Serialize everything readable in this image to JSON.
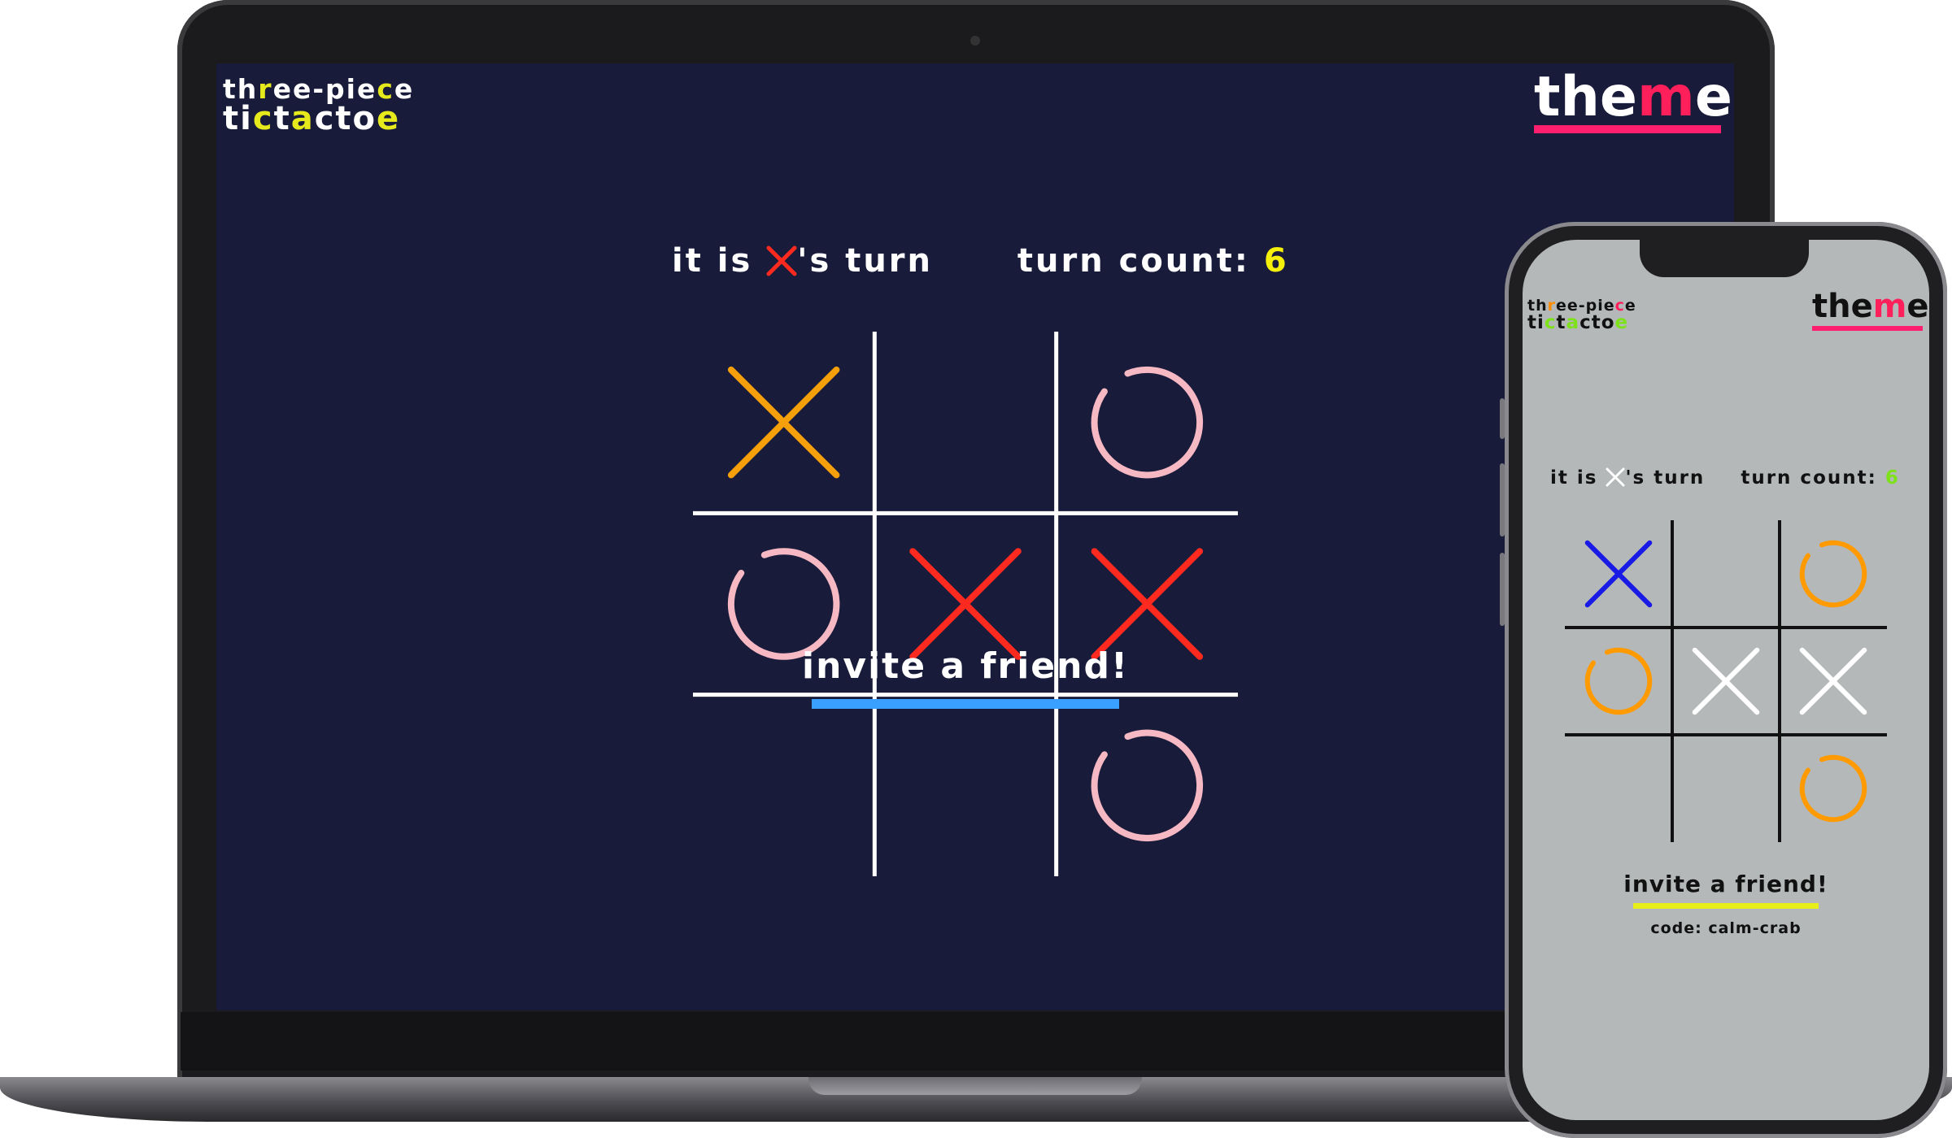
{
  "laptop": {
    "brand": {
      "line1": [
        "th",
        "r",
        "ee-pie",
        "c",
        "e"
      ],
      "line2": [
        "ti",
        "c",
        "t",
        "a",
        "cto",
        "e"
      ]
    },
    "theme_label": [
      "the",
      "m",
      "e"
    ],
    "status": {
      "prefix": "it is",
      "suffix": "'s turn",
      "count_label": "turn count:",
      "count_value": "6"
    },
    "board": [
      "X",
      "",
      "O",
      "O",
      "X",
      "X",
      "",
      "",
      "O"
    ],
    "invite_label": "invite a friend!",
    "colors": {
      "bg": "#191b3a",
      "x1": "#f5a00a",
      "x": "#ff2a1f",
      "o": "#f6b9c4",
      "grid": "#ffffff",
      "accent": "#3aa0ff",
      "theme_bar": "#ff1f6e",
      "count": "#f4f00a"
    }
  },
  "phone": {
    "brand": {
      "line1": [
        "th",
        "r",
        "ee-pie",
        "c",
        "e"
      ],
      "line2": [
        "ti",
        "c",
        "t",
        "a",
        "cto",
        "e"
      ]
    },
    "theme_label": [
      "the",
      "m",
      "e"
    ],
    "status": {
      "prefix": "it is",
      "suffix": "'s turn",
      "count_label": "turn count:",
      "count_value": "6"
    },
    "board": [
      "X",
      "",
      "O",
      "O",
      "X",
      "X",
      "",
      "",
      "O"
    ],
    "invite_label": "invite a friend!",
    "code_label": "code: calm-crab",
    "colors": {
      "bg": "#b4b8b8",
      "x1": "#1a1ae6",
      "x": "#ffffff",
      "o": "#ff9a00",
      "grid": "#111111",
      "accent": "#e8ee1a",
      "theme_bar": "#ff1f6e",
      "count": "#7ee21b"
    }
  }
}
